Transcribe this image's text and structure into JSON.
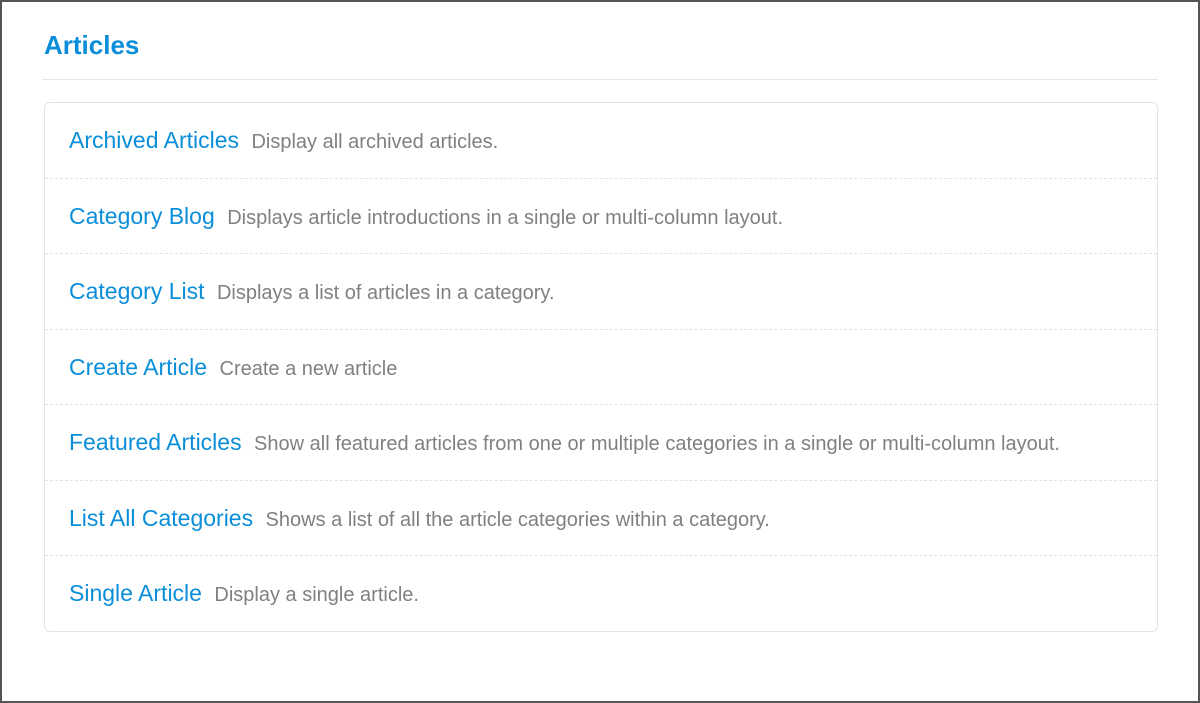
{
  "section": {
    "title": "Articles"
  },
  "items": [
    {
      "label": "Archived Articles",
      "desc": "Display all archived articles."
    },
    {
      "label": "Category Blog",
      "desc": "Displays article introductions in a single or multi-column layout."
    },
    {
      "label": "Category List",
      "desc": "Displays a list of articles in a category."
    },
    {
      "label": "Create Article",
      "desc": "Create a new article"
    },
    {
      "label": "Featured Articles",
      "desc": "Show all featured articles from one or multiple categories in a single or multi-column layout."
    },
    {
      "label": "List All Categories",
      "desc": "Shows a list of all the article categories within a category."
    },
    {
      "label": "Single Article",
      "desc": "Display a single article."
    }
  ]
}
